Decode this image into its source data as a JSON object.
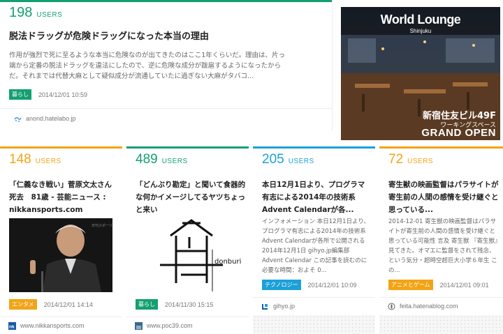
{
  "top_card": {
    "users": "198",
    "users_unit": "USERS",
    "title": "脱法ドラッグが危険ドラッグになった本当の理由",
    "summary": "作用が強烈で死に至るような本当に危険なのが出てきたのはここ1年くらいだ。理由は、片っ端から定番の脱法ドラッグを違法にしたので、逆に危険な成分が跋扈するようになったからだ。それまでは代替大麻として疑似成分が流通していたに過ぎない大麻がタバコ...",
    "tag": "暮らし",
    "date": "2014/12/01 10:59",
    "source": "anond.hatelabo.jp",
    "accent": "#13a070"
  },
  "ad": {
    "title": "World Lounge",
    "subtitle": "Shinjuku",
    "line1": "新宿住友ビル49F",
    "line2": "ワーキングスペース",
    "line3": "GRAND OPEN"
  },
  "cards": [
    {
      "users": "148",
      "users_unit": "USERS",
      "title": "「仁義なき戦い」菅原文太さん死去　81歳 - 芸能ニュース : nikkansports.com",
      "tag": "エンタメ",
      "date": "2014/12/01 14:14",
      "source": "www.nikkansports.com",
      "accent": "#f3a416"
    },
    {
      "users": "489",
      "users_unit": "USERS",
      "title": "「どんぶり勘定」と聞いて食器的な何かイメージしてるヤツちょっと来い",
      "image_caption": "donburi",
      "tag": "暮らし",
      "date": "2014/11/30 15:15",
      "source": "www.poc39.com",
      "accent": "#13a070"
    },
    {
      "users": "205",
      "users_unit": "USERS",
      "title": "本日12月1日より、プログラマ有志による2014年の技術系Advent Calendarが各...",
      "summary": "インフォメーション 本日12月1日より、プログラマ有志による2014年の技術系Advent Calendarが各所で公開される 2014年12月1日 gihyo.jp編集部 Advent Calendar この記事を読むのに必要な時間：およそ 0...",
      "tag": "テクノロジー",
      "date": "2014/12/01 10:09",
      "source": "gihyo.jp",
      "accent": "#1ca0d8"
    },
    {
      "users": "72",
      "users_unit": "USERS",
      "title": "寄生獣の映画監督はパラサイトが寄生前の人間の感情を受け継ぐと思っている...",
      "summary": "2014-12-01 寄生獣の映画監督はパラサイトが寄生前の人間の感情を受け継ぐと思っている可能性 言及 寄生獣 『寄生獣』見てきた。オマエに監督をされて残念、という気分・超時空超巨大小学６年生 この...",
      "tag": "アニメとゲーム",
      "date": "2014/12/01 09:01",
      "source": "feita.hatenablog.com",
      "accent": "#f3a416"
    }
  ]
}
